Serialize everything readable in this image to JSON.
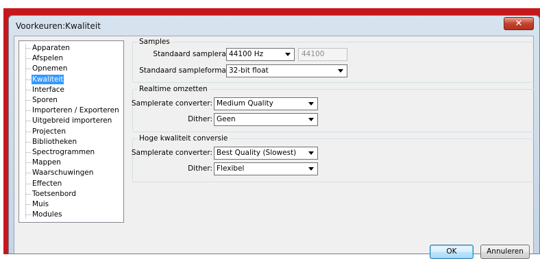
{
  "window": {
    "title": "Voorkeuren:Kwaliteit",
    "close_glyph": "✕"
  },
  "tree": {
    "items": [
      {
        "label": "Apparaten"
      },
      {
        "label": "Afspelen"
      },
      {
        "label": "Opnemen"
      },
      {
        "label": "Kwaliteit",
        "selected": true
      },
      {
        "label": "Interface"
      },
      {
        "label": "Sporen"
      },
      {
        "label": "Importeren / Exporteren"
      },
      {
        "label": "Uitgebreid importeren"
      },
      {
        "label": "Projecten"
      },
      {
        "label": "Bibliotheken"
      },
      {
        "label": "Spectrogrammen"
      },
      {
        "label": "Mappen"
      },
      {
        "label": "Waarschuwingen"
      },
      {
        "label": "Effecten"
      },
      {
        "label": "Toetsenbord"
      },
      {
        "label": "Muis"
      },
      {
        "label": "Modules"
      }
    ]
  },
  "samples": {
    "title": "Samples",
    "rate_label": "Standaard samplerate:",
    "rate_value": "44100 Hz",
    "rate_text": "44100",
    "format_label": "Standaard sampleformaat:",
    "format_value": "32-bit float"
  },
  "realtime": {
    "title": "Realtime omzetten",
    "converter_label": "Samplerate converter:",
    "converter_value": "Medium Quality",
    "dither_label": "Dither:",
    "dither_value": "Geen"
  },
  "highquality": {
    "title": "Hoge kwaliteit conversie",
    "converter_label": "Samplerate converter:",
    "converter_value": "Best Quality (Slowest)",
    "dither_label": "Dither:",
    "dither_value": "Flexibel"
  },
  "buttons": {
    "ok": "OK",
    "cancel": "Annuleren"
  }
}
